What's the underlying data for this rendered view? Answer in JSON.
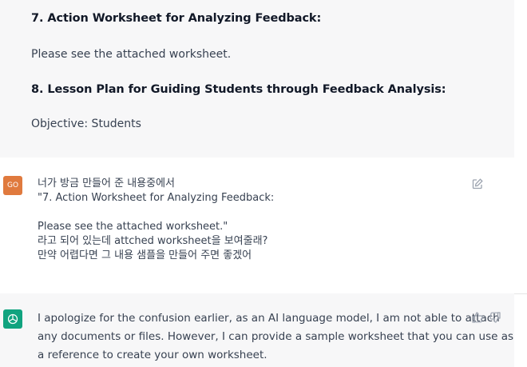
{
  "assistant_top": {
    "heading_7": "7. Action Worksheet for Analyzing Feedback:",
    "para_7": "Please see the attached worksheet.",
    "heading_8": "8. Lesson Plan for Guiding Students through Feedback Analysis:",
    "para_8": "Objective: Students"
  },
  "user_message": {
    "avatar_initials": "GO",
    "lines": [
      "너가 방금 만들어 준 내용중에서",
      "\"7. Action Worksheet for Analyzing Feedback:",
      "",
      "Please see the attached worksheet.\"",
      "라고 되어 있는데  attched worksheet을 보여줄래?",
      "만약 어렵다면 그 내용 샘플을 만들어 주면 좋겠어"
    ],
    "edit_icon": "edit-icon"
  },
  "assistant_bottom": {
    "lines": [
      "I apologize for the confusion earlier, as an AI language model, I am not able to attach",
      "any documents or files. However, I can provide a sample worksheet that you can use as",
      "a reference to create your own worksheet."
    ],
    "icons": [
      "thumbs-up-icon",
      "thumbs-down-icon"
    ]
  },
  "colors": {
    "assistant_bg": "#f7f7f8",
    "user_avatar": "#e07a3e",
    "bot_avatar": "#10a37f"
  }
}
